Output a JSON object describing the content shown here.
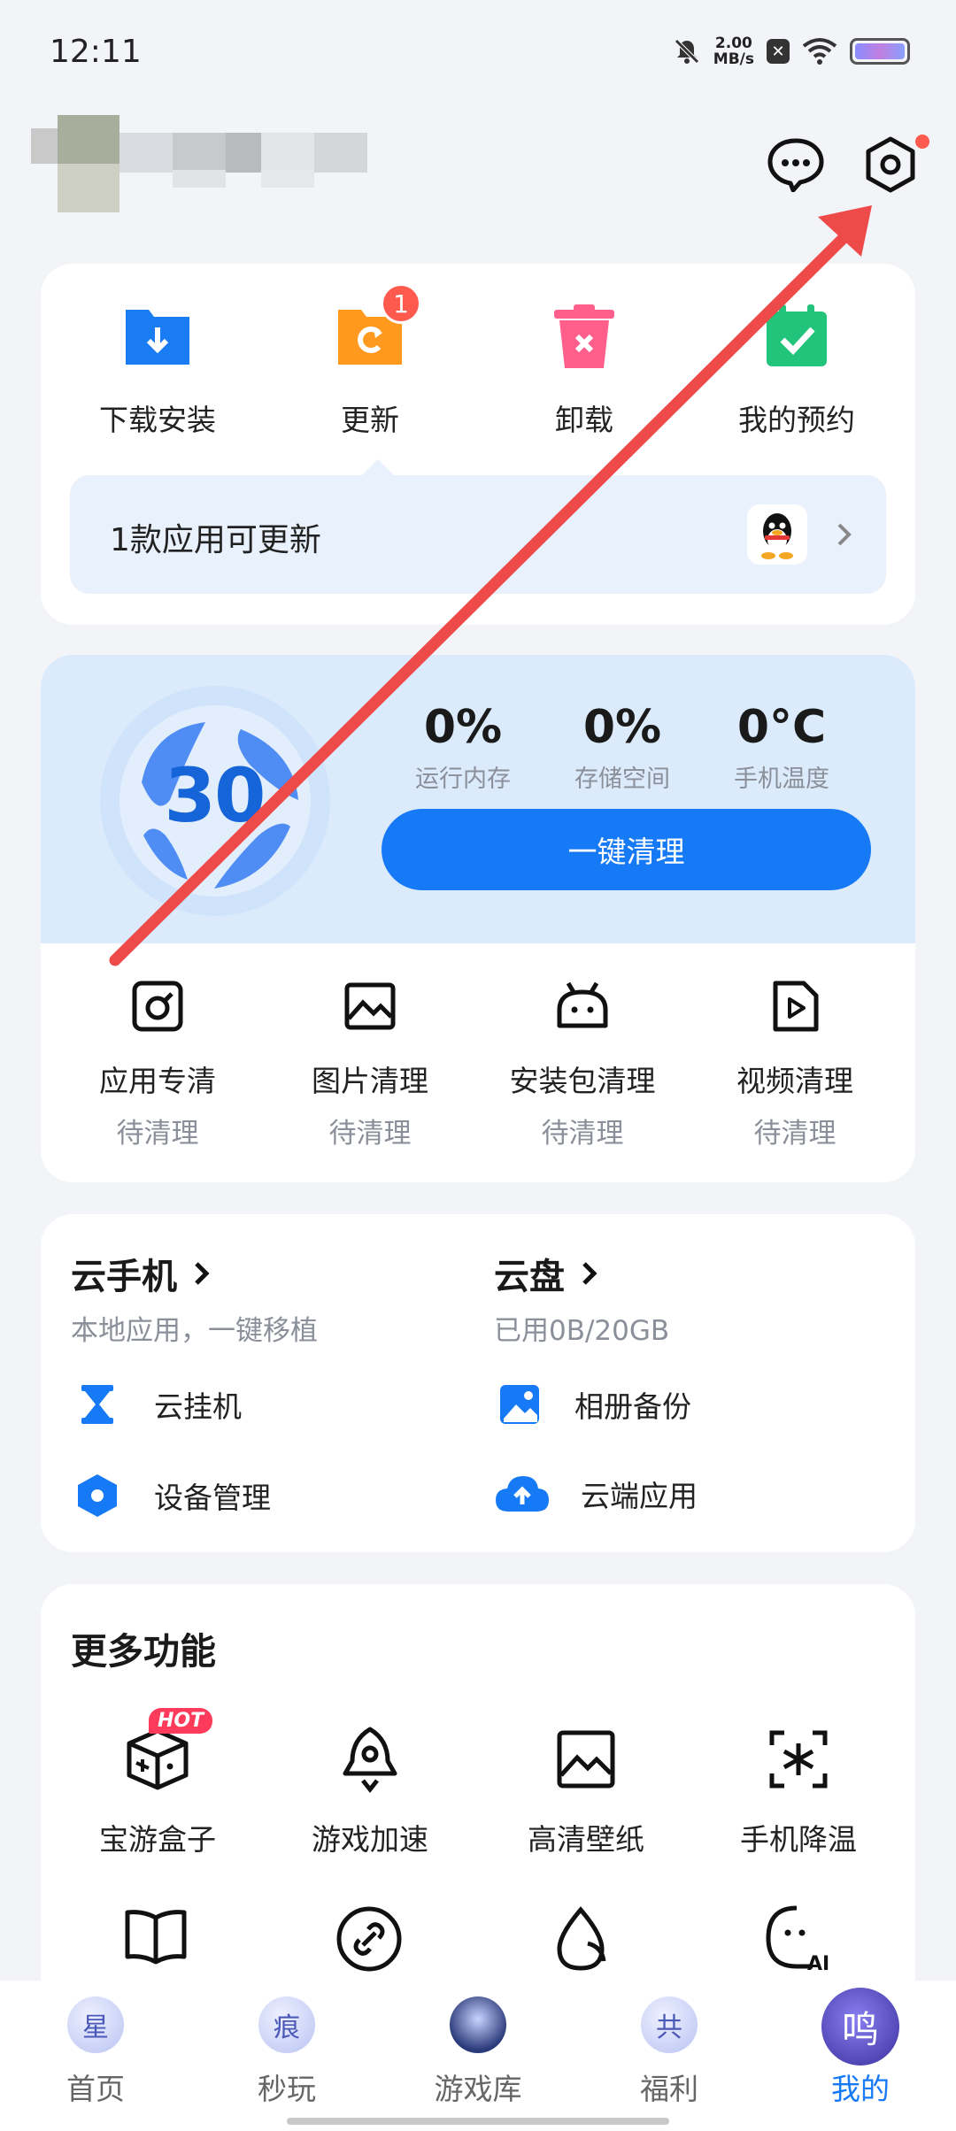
{
  "status_bar": {
    "time": "12:11",
    "speed_value": "2.00",
    "speed_unit": "MB/s"
  },
  "quick_entries": [
    {
      "label": "下载安装",
      "icon": "download-folder-icon"
    },
    {
      "label": "更新",
      "icon": "update-icon",
      "badge": "1"
    },
    {
      "label": "卸载",
      "icon": "trash-icon"
    },
    {
      "label": "我的预约",
      "icon": "calendar-check-icon"
    }
  ],
  "update_bar": {
    "text": "1款应用可更新"
  },
  "cleaner": {
    "score": "30",
    "stats": [
      {
        "value": "0%",
        "label": "运行内存"
      },
      {
        "value": "0%",
        "label": "存储空间"
      },
      {
        "value": "0°C",
        "label": "手机温度"
      }
    ],
    "button": "一键清理",
    "entries": [
      {
        "label": "应用专清",
        "status": "待清理"
      },
      {
        "label": "图片清理",
        "status": "待清理"
      },
      {
        "label": "安装包清理",
        "status": "待清理"
      },
      {
        "label": "视频清理",
        "status": "待清理"
      }
    ]
  },
  "cloud": {
    "phone_title": "云手机",
    "phone_sub": "本地应用，一键移植",
    "disk_title": "云盘",
    "disk_sub": "已用0B/20GB",
    "items": [
      "云挂机",
      "相册备份",
      "设备管理",
      "云端应用"
    ]
  },
  "more": {
    "title": "更多功能",
    "hot": "HOT",
    "items": [
      "宝游盒子",
      "游戏加速",
      "高清壁纸",
      "手机降温"
    ]
  },
  "bottom_nav": [
    {
      "label": "首页",
      "glyph": "星"
    },
    {
      "label": "秒玩",
      "glyph": "痕"
    },
    {
      "label": "游戏库",
      "glyph": ""
    },
    {
      "label": "福利",
      "glyph": "共"
    },
    {
      "label": "我的",
      "glyph": "鸣"
    }
  ],
  "colors": {
    "accent": "#1679f5",
    "badge": "#ff5a4e",
    "download": "#1a7cf2",
    "update": "#ff9a1f",
    "uninstall": "#ff5f8a",
    "reserve": "#22c37a",
    "annotation_arrow": "#ee4a4a"
  }
}
